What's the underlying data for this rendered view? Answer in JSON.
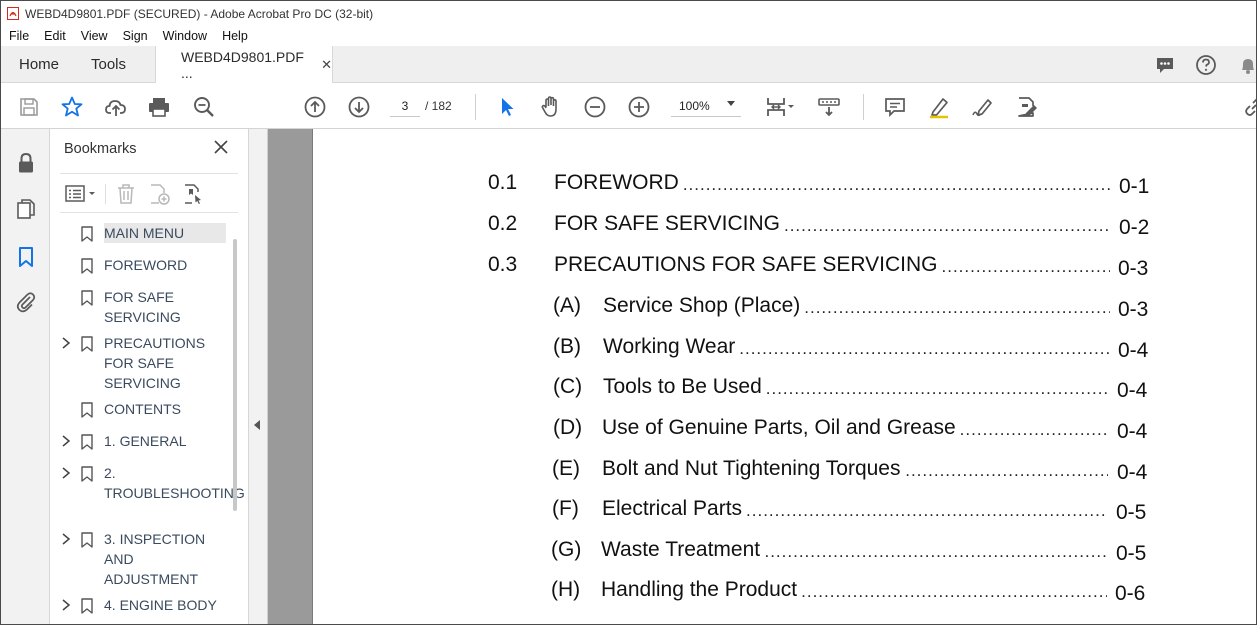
{
  "window": {
    "title": "WEBD4D9801.PDF (SECURED) - Adobe Acrobat Pro DC (32-bit)"
  },
  "menu": [
    "File",
    "Edit",
    "View",
    "Sign",
    "Window",
    "Help"
  ],
  "tabs": {
    "home": "Home",
    "tools": "Tools",
    "document": "WEBD4D9801.PDF ...",
    "close_glyph": "✕"
  },
  "toolbar": {
    "page_current": "3",
    "page_total": "/  182",
    "zoom": "100%"
  },
  "bookmarks": {
    "header": "Bookmarks",
    "close_glyph": "✕",
    "items": [
      {
        "label": "MAIN MENU",
        "expandable": false,
        "selected": true
      },
      {
        "label": "FOREWORD",
        "expandable": false
      },
      {
        "label": "FOR SAFE SERVICING",
        "expandable": false
      },
      {
        "label": "PRECAUTIONS FOR SAFE SERVICING",
        "expandable": true
      },
      {
        "label": "CONTENTS",
        "expandable": false
      },
      {
        "label": "1.  GENERAL",
        "expandable": true
      },
      {
        "label": "2. TROUBLESHOOTING",
        "expandable": true
      },
      {
        "label": "3.  INSPECTION AND ADJUSTMENT",
        "expandable": true
      },
      {
        "label": "4. ENGINE BODY",
        "expandable": true
      }
    ]
  },
  "toc": [
    {
      "num": "0.1",
      "title": "FOREWORD",
      "page": "0-1"
    },
    {
      "num": "0.2",
      "title": "FOR SAFE SERVICING",
      "page": "0-2"
    },
    {
      "num": "0.3",
      "title": "PRECAUTIONS FOR SAFE SERVICING",
      "page": "0-3"
    },
    {
      "num": "(A)",
      "title": "Service Shop (Place)",
      "page": "0-3"
    },
    {
      "num": "(B)",
      "title": "Working Wear",
      "page": "0-4"
    },
    {
      "num": "(C)",
      "title": "Tools to Be Used",
      "page": "0-4"
    },
    {
      "num": "(D)",
      "title": "Use of Genuine Parts, Oil and Grease",
      "page": "0-4"
    },
    {
      "num": "(E)",
      "title": "Bolt and Nut Tightening Torques",
      "page": "0-4"
    },
    {
      "num": "(F)",
      "title": "Electrical Parts",
      "page": "0-5"
    },
    {
      "num": "(G)",
      "title": "Waste Treatment",
      "page": "0-5"
    },
    {
      "num": "(H)",
      "title": "Handling the Product",
      "page": "0-6"
    }
  ],
  "colors": {
    "accent_blue": "#1473e6",
    "icon_gray": "#5a5a5a",
    "pdf_red": "#d9291c"
  }
}
